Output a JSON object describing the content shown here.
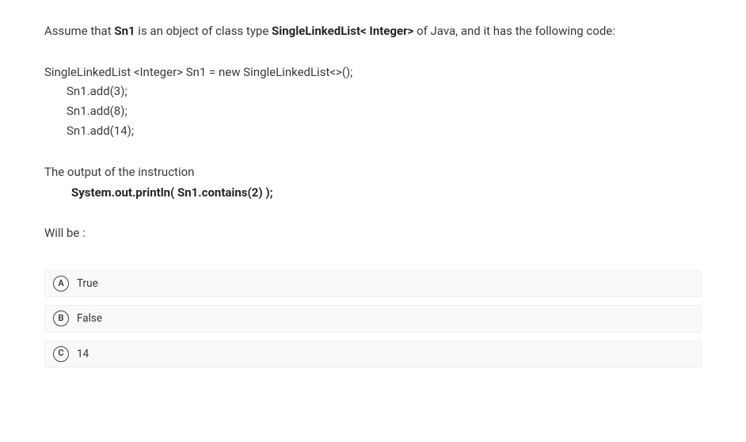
{
  "intro": {
    "p1_a": "Assume that ",
    "p1_b": "Sn1",
    "p1_c": " is an object of class type ",
    "p1_d": "SingleLinkedList< Integer>",
    "p1_e": " of Java, and it has the following code:"
  },
  "code": {
    "l1": "SingleLinkedList <Integer> Sn1 = new SingleLinkedList<>();",
    "l2": "Sn1.add(3);",
    "l3": "Sn1.add(8);",
    "l4": "Sn1.add(14);"
  },
  "output_section": {
    "label": "The output of the instruction",
    "print": "System.out.println( Sn1.contains(2) );"
  },
  "willbe": "Will be :",
  "options": [
    {
      "letter": "A",
      "label": "True"
    },
    {
      "letter": "B",
      "label": "False"
    },
    {
      "letter": "C",
      "label": "14"
    }
  ]
}
